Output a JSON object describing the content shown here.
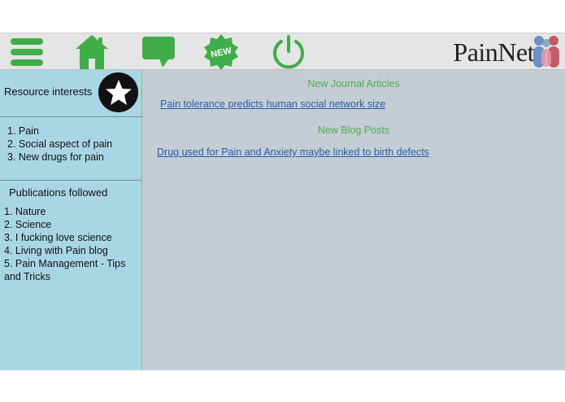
{
  "toolbar": {
    "icons": [
      "menu-icon",
      "home-icon",
      "chat-icon",
      "new-badge-icon",
      "power-icon"
    ],
    "new_badge_text": "NEW",
    "accent_color": "#3fae4a"
  },
  "logo": {
    "text": "PainNet"
  },
  "sidebar": {
    "resource_title": "Resource interests",
    "resource_items": [
      "1. Pain",
      "2. Social aspect of pain",
      "3. New drugs for pain"
    ],
    "publications_title": "Publications followed",
    "publications_items": [
      "1. Nature",
      "2. Science",
      "3. I fucking love science",
      "4. Living with Pain blog",
      "5. Pain Management - Tips and Tricks"
    ]
  },
  "main": {
    "journal_heading": "New Journal Articles",
    "journal_link": "Pain tolerance predicts human social network size",
    "blog_heading": "New Blog Posts",
    "blog_link": "Drug used for Pain and Anxiety maybe linked to birth defects"
  },
  "colors": {
    "toolbar_bg": "#e5e5e5",
    "sidebar_bg": "#a9d6e5",
    "main_bg": "#c4cdd4",
    "heading_green": "#4caf50",
    "link_blue": "#2a5db0"
  }
}
